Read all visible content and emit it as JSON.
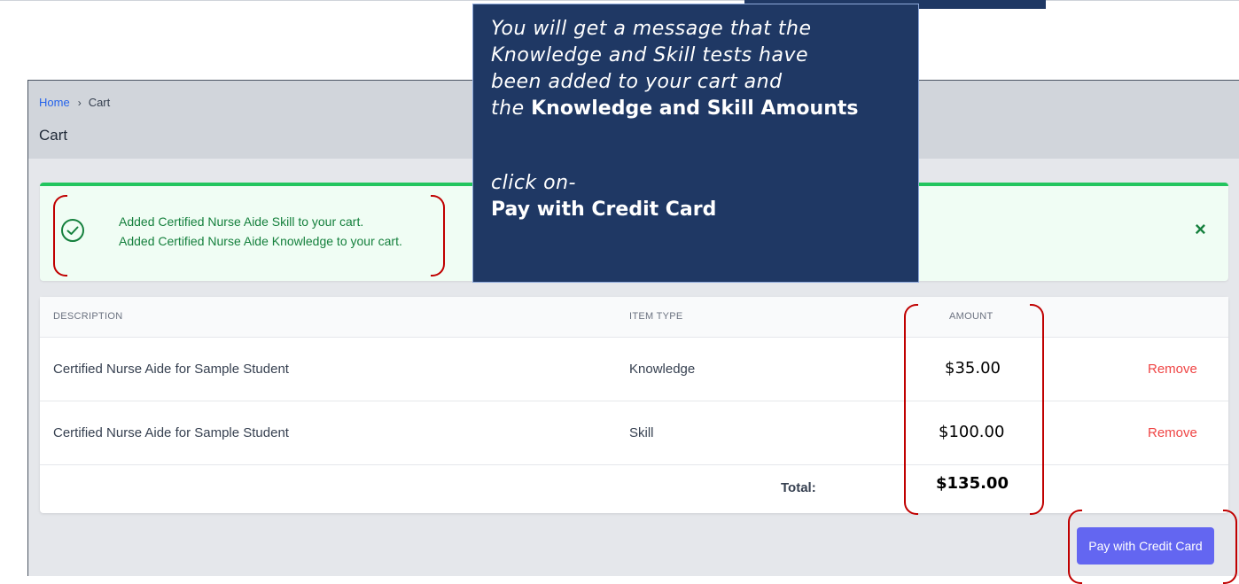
{
  "breadcrumb": {
    "home": "Home",
    "separator": "›",
    "current": "Cart"
  },
  "page_title": "Cart",
  "alert": {
    "messages": [
      "Added Certified Nurse Aide Skill to your cart.",
      "Added Certified Nurse Aide Knowledge to your cart."
    ],
    "close": "×"
  },
  "table": {
    "headers": {
      "description": "DESCRIPTION",
      "item_type": "ITEM TYPE",
      "amount": "AMOUNT"
    },
    "rows": [
      {
        "description": "Certified Nurse Aide for Sample Student",
        "item_type": "Knowledge",
        "amount": "$35.00",
        "action": "Remove"
      },
      {
        "description": "Certified Nurse Aide for Sample Student",
        "item_type": "Skill",
        "amount": "$100.00",
        "action": "Remove"
      }
    ],
    "total_label": "Total:",
    "total_value": "$135.00"
  },
  "pay_button": "Pay with Credit Card",
  "callout": {
    "line1": "You will get a message that the",
    "line2": "Knowledge and Skill tests have",
    "line3": "been added to your cart and",
    "line4_italic": "the",
    "line4_bold": "Knowledge and Skill Amounts",
    "line5": "click on-",
    "line6": "Pay with Credit Card"
  },
  "colors": {
    "accent": "#6366f1",
    "success": "#22c55e",
    "danger": "#ef4444",
    "callout_bg": "#1f3864",
    "highlight": "#c00000"
  }
}
